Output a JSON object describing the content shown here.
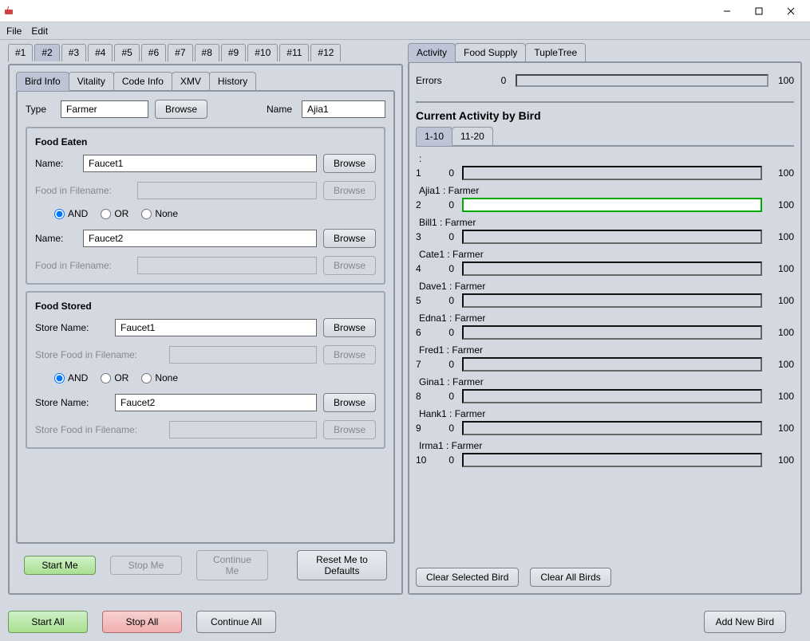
{
  "menubar": {
    "file": "File",
    "edit": "Edit"
  },
  "workspace_tabs": [
    "#1",
    "#2",
    "#3",
    "#4",
    "#5",
    "#6",
    "#7",
    "#8",
    "#9",
    "#10",
    "#11",
    "#12"
  ],
  "workspace_active": "#2",
  "bird_tabs": [
    "Bird Info",
    "Vitality",
    "Code Info",
    "XMV",
    "History"
  ],
  "bird_tab_active": "Bird Info",
  "type_label": "Type",
  "type_value": "Farmer",
  "browse": "Browse",
  "name_label": "Name",
  "name_value": "Ajia1",
  "food_eaten": {
    "title": "Food Eaten",
    "name_label": "Name:",
    "name1": "Faucet1",
    "fif_label": "Food in Filename:",
    "name2": "Faucet2"
  },
  "radios": {
    "and": "AND",
    "or": "OR",
    "none": "None"
  },
  "food_stored": {
    "title": "Food Stored",
    "store_label": "Store Name:",
    "store1": "Faucet1",
    "sfif_label": "Store Food in Filename:",
    "store2": "Faucet2"
  },
  "btns": {
    "start_me": "Start Me",
    "stop_me": "Stop Me",
    "continue_me": "Continue Me",
    "reset_me": "Reset Me to Defaults",
    "start_all": "Start All",
    "stop_all": "Stop All",
    "continue_all": "Continue All",
    "add_new": "Add New Bird",
    "clear_selected": "Clear Selected Bird",
    "clear_all": "Clear All Birds"
  },
  "right_tabs": [
    "Activity",
    "Food Supply",
    "TupleTree"
  ],
  "right_tab_active": "Activity",
  "errors_label": "Errors",
  "errors_value": "0",
  "errors_max": "100",
  "activity_title": "Current Activity by Bird",
  "page_tabs": [
    "1-10",
    "11-20"
  ],
  "page_active": "1-10",
  "birds": [
    {
      "idx": "1",
      "label": ":",
      "min": "0",
      "max": "100",
      "active": false
    },
    {
      "idx": "2",
      "label": "Ajia1 : Farmer",
      "min": "0",
      "max": "100",
      "active": true
    },
    {
      "idx": "3",
      "label": "Bill1 : Farmer",
      "min": "0",
      "max": "100",
      "active": false
    },
    {
      "idx": "4",
      "label": "Cate1 : Farmer",
      "min": "0",
      "max": "100",
      "active": false
    },
    {
      "idx": "5",
      "label": "Dave1 : Farmer",
      "min": "0",
      "max": "100",
      "active": false
    },
    {
      "idx": "6",
      "label": "Edna1 : Farmer",
      "min": "0",
      "max": "100",
      "active": false
    },
    {
      "idx": "7",
      "label": "Fred1 : Farmer",
      "min": "0",
      "max": "100",
      "active": false
    },
    {
      "idx": "8",
      "label": "Gina1 : Farmer",
      "min": "0",
      "max": "100",
      "active": false
    },
    {
      "idx": "9",
      "label": "Hank1 : Farmer",
      "min": "0",
      "max": "100",
      "active": false
    },
    {
      "idx": "10",
      "label": "Irma1 : Farmer",
      "min": "0",
      "max": "100",
      "active": false
    }
  ]
}
